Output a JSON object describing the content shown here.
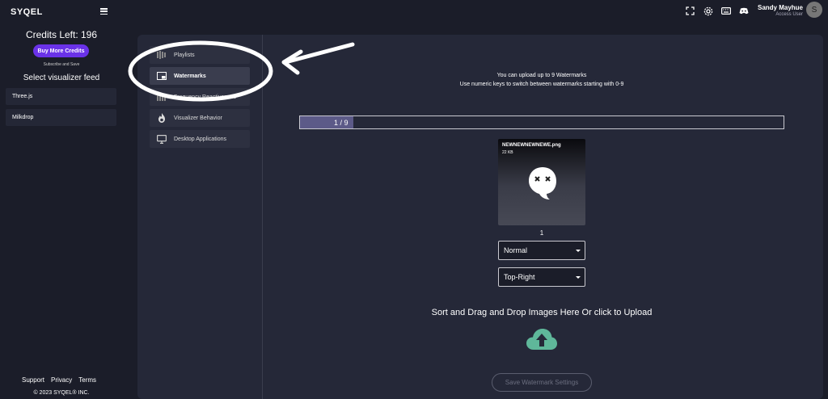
{
  "header": {
    "logo": "SYQEL",
    "icons": [
      "fullscreen-icon",
      "gear-icon",
      "keyboard-icon",
      "discord-icon"
    ],
    "user_name": "Sandy Mayhue",
    "user_role": "Access User",
    "avatar_initial": "S"
  },
  "sidebar": {
    "credits_label": "Credits Left: 196",
    "buy_button": "Buy More Credits",
    "subscribe_text": "Subscribe and Save",
    "feed_title": "Select visualizer feed",
    "feeds": [
      {
        "label": "Three.js"
      },
      {
        "label": "Milkdrop"
      }
    ],
    "footer_links": [
      {
        "label": "Support"
      },
      {
        "label": "Privacy"
      },
      {
        "label": "Terms"
      }
    ],
    "copyright": "© 2023 SYQEL® INC."
  },
  "nav": {
    "items": [
      {
        "label": "Playlists",
        "icon": "playlist-icon",
        "active": false
      },
      {
        "label": "Watermarks",
        "icon": "watermark-icon",
        "active": true
      },
      {
        "label": "Frequency Reactiveness",
        "icon": "frequency-icon",
        "active": false
      },
      {
        "label": "Visualizer Behavior",
        "icon": "flame-icon",
        "active": false
      },
      {
        "label": "Desktop Applications",
        "icon": "monitor-icon",
        "active": false
      }
    ]
  },
  "main": {
    "info_line1": "You can upload up to 9 Watermarks",
    "info_line2": "Use numeric keys to switch between watermarks starting with 0-9",
    "progress_text": "1 / 9",
    "progress_fraction": 0.111,
    "watermark": {
      "filename": "NEWNEWNEWNEWE.png",
      "size": "22 KB",
      "index": "1"
    },
    "blend_mode": "Normal",
    "position": "Top-Right",
    "drop_text": "Sort and Drag and Drop Images Here Or click to Upload",
    "save_button": "Save Watermark Settings"
  },
  "colors": {
    "background": "#1b1d29",
    "panel": "#252838",
    "accent_button": "#6a32e8",
    "progress_fill": "#5c5a88",
    "upload_icon": "#5fb79a"
  }
}
